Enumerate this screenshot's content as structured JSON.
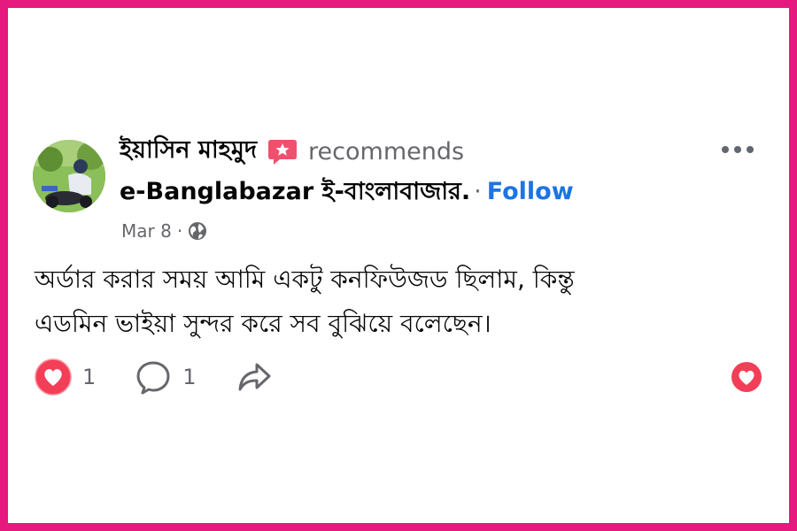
{
  "post": {
    "author_name": "ইয়াসিন মাহমুদ",
    "recommends_label": "recommends",
    "page_name": "e-Banglabazar ই-বাংলাবাজার.",
    "separator": "·",
    "follow_label": "Follow",
    "date": "Mar 8",
    "date_separator": "·",
    "privacy_icon": "globe-icon",
    "badge_icon": "recommend-badge-icon",
    "text_line1": "অর্ডার করার সময় আমি একটু কনফিউজড ছিলাম, কিন্তু",
    "text_line2": "এডমিন ভাইয়া সুন্দর করে সব বুঝিয়ে বলেছেন।"
  },
  "actions": {
    "likes_count": "1",
    "comments_count": "1",
    "like_icon": "heart-icon",
    "comment_icon": "comment-bubble-icon",
    "share_icon": "share-arrow-icon",
    "react_icon": "love-react-icon"
  },
  "colors": {
    "frame": "#e6197e",
    "follow": "#1b74e4",
    "heart": "#f33e58",
    "secondary_text": "#65676b"
  }
}
